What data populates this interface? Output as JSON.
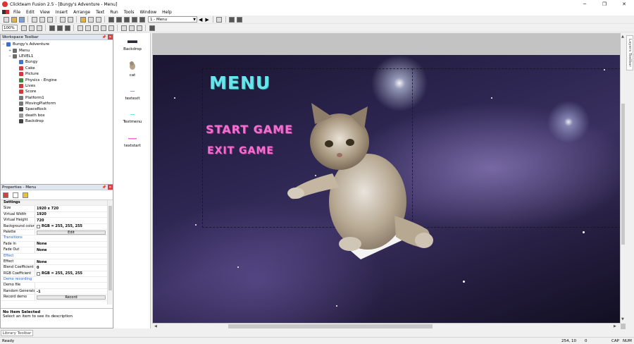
{
  "window": {
    "title": "Clickteam Fusion 2.5 - [Bungy's Adventure - Menu]",
    "controls": [
      "minimize-icon",
      "restore-icon",
      "close-icon"
    ]
  },
  "menubar": {
    "items": [
      "File",
      "Edit",
      "View",
      "Insert",
      "Arrange",
      "Text",
      "Run",
      "Tools",
      "Window",
      "Help"
    ]
  },
  "toolbar": {
    "frame_select": "1 - Menu",
    "zoom": "100%"
  },
  "workspace": {
    "title": "Workspace Toolbar",
    "tree": [
      {
        "label": "Bungy's Adventure",
        "level": 0,
        "expander": "−",
        "icon_color": "#3b6fd0"
      },
      {
        "label": "Menu",
        "level": 1,
        "expander": "+",
        "icon_color": "#6d6d6d"
      },
      {
        "label": "LEVEL1",
        "level": 1,
        "expander": "−",
        "icon_color": "#6d6d6d"
      },
      {
        "label": "Bungy",
        "level": 2,
        "expander": "",
        "icon_color": "#4a6fd0"
      },
      {
        "label": "Cake",
        "level": 2,
        "expander": "",
        "icon_color": "#d23a3a"
      },
      {
        "label": "Picture",
        "level": 2,
        "expander": "",
        "icon_color": "#d23a3a"
      },
      {
        "label": "Physics - Engine",
        "level": 2,
        "expander": "",
        "icon_color": "#3a8a3a"
      },
      {
        "label": "Lives",
        "level": 2,
        "expander": "",
        "icon_color": "#d23a3a"
      },
      {
        "label": "Score",
        "level": 2,
        "expander": "",
        "icon_color": "#d23a3a"
      },
      {
        "label": "Platform1",
        "level": 2,
        "expander": "",
        "icon_color": "#777777"
      },
      {
        "label": "MovingPlatform",
        "level": 2,
        "expander": "",
        "icon_color": "#777777"
      },
      {
        "label": "SpaceRock",
        "level": 2,
        "expander": "",
        "icon_color": "#444444"
      },
      {
        "label": "death box",
        "level": 2,
        "expander": "",
        "icon_color": "#999999"
      },
      {
        "label": "Backdrop",
        "level": 2,
        "expander": "",
        "icon_color": "#444444"
      }
    ]
  },
  "properties": {
    "title": "Properties - Menu",
    "rows": [
      {
        "kind": "section",
        "name": "Settings"
      },
      {
        "kind": "prop",
        "name": "Size",
        "value": "1920 x 720"
      },
      {
        "kind": "prop",
        "name": "Virtual Width",
        "value": "1920"
      },
      {
        "kind": "prop",
        "name": "Virtual Height",
        "value": "720"
      },
      {
        "kind": "prop",
        "name": "Background color",
        "value": "RGB = 255, 255, 255",
        "swatch": true
      },
      {
        "kind": "prop",
        "name": "Palette",
        "value": "Edit",
        "button": true
      },
      {
        "kind": "cat",
        "name": "Transitions"
      },
      {
        "kind": "prop",
        "name": "Fade In",
        "value": "None"
      },
      {
        "kind": "prop",
        "name": "Fade Out",
        "value": "None"
      },
      {
        "kind": "cat",
        "name": "Effect"
      },
      {
        "kind": "prop",
        "name": "Effect",
        "value": "None"
      },
      {
        "kind": "prop",
        "name": "Blend Coefficient",
        "value": "0"
      },
      {
        "kind": "prop",
        "name": "RGB Coefficient",
        "value": "RGB = 255, 255, 255",
        "swatch": true
      },
      {
        "kind": "cat",
        "name": "Demo recording"
      },
      {
        "kind": "prop",
        "name": "Demo file",
        "value": ""
      },
      {
        "kind": "prop",
        "name": "Random Generator",
        "value": "-1"
      },
      {
        "kind": "prop",
        "name": "Record demo",
        "value": "Record",
        "button": true
      }
    ],
    "desc_title": "No Item Selected",
    "desc_text": "Select an item to see its description"
  },
  "library_tab": "Library Toolbar",
  "frame_objects": [
    {
      "label": "Backdrop"
    },
    {
      "label": "cat"
    },
    {
      "label": "textexit"
    },
    {
      "label": "Textmenu"
    },
    {
      "label": "textstart"
    }
  ],
  "game": {
    "menu_title": "MENU",
    "start_text": "START GAME",
    "exit_text": "EXIT GAME"
  },
  "layers_tab": "Layers Toolbar",
  "status": {
    "ready": "Ready",
    "coords": "254, 10",
    "objects": "0",
    "caps": "CAP",
    "num": "NUM"
  }
}
